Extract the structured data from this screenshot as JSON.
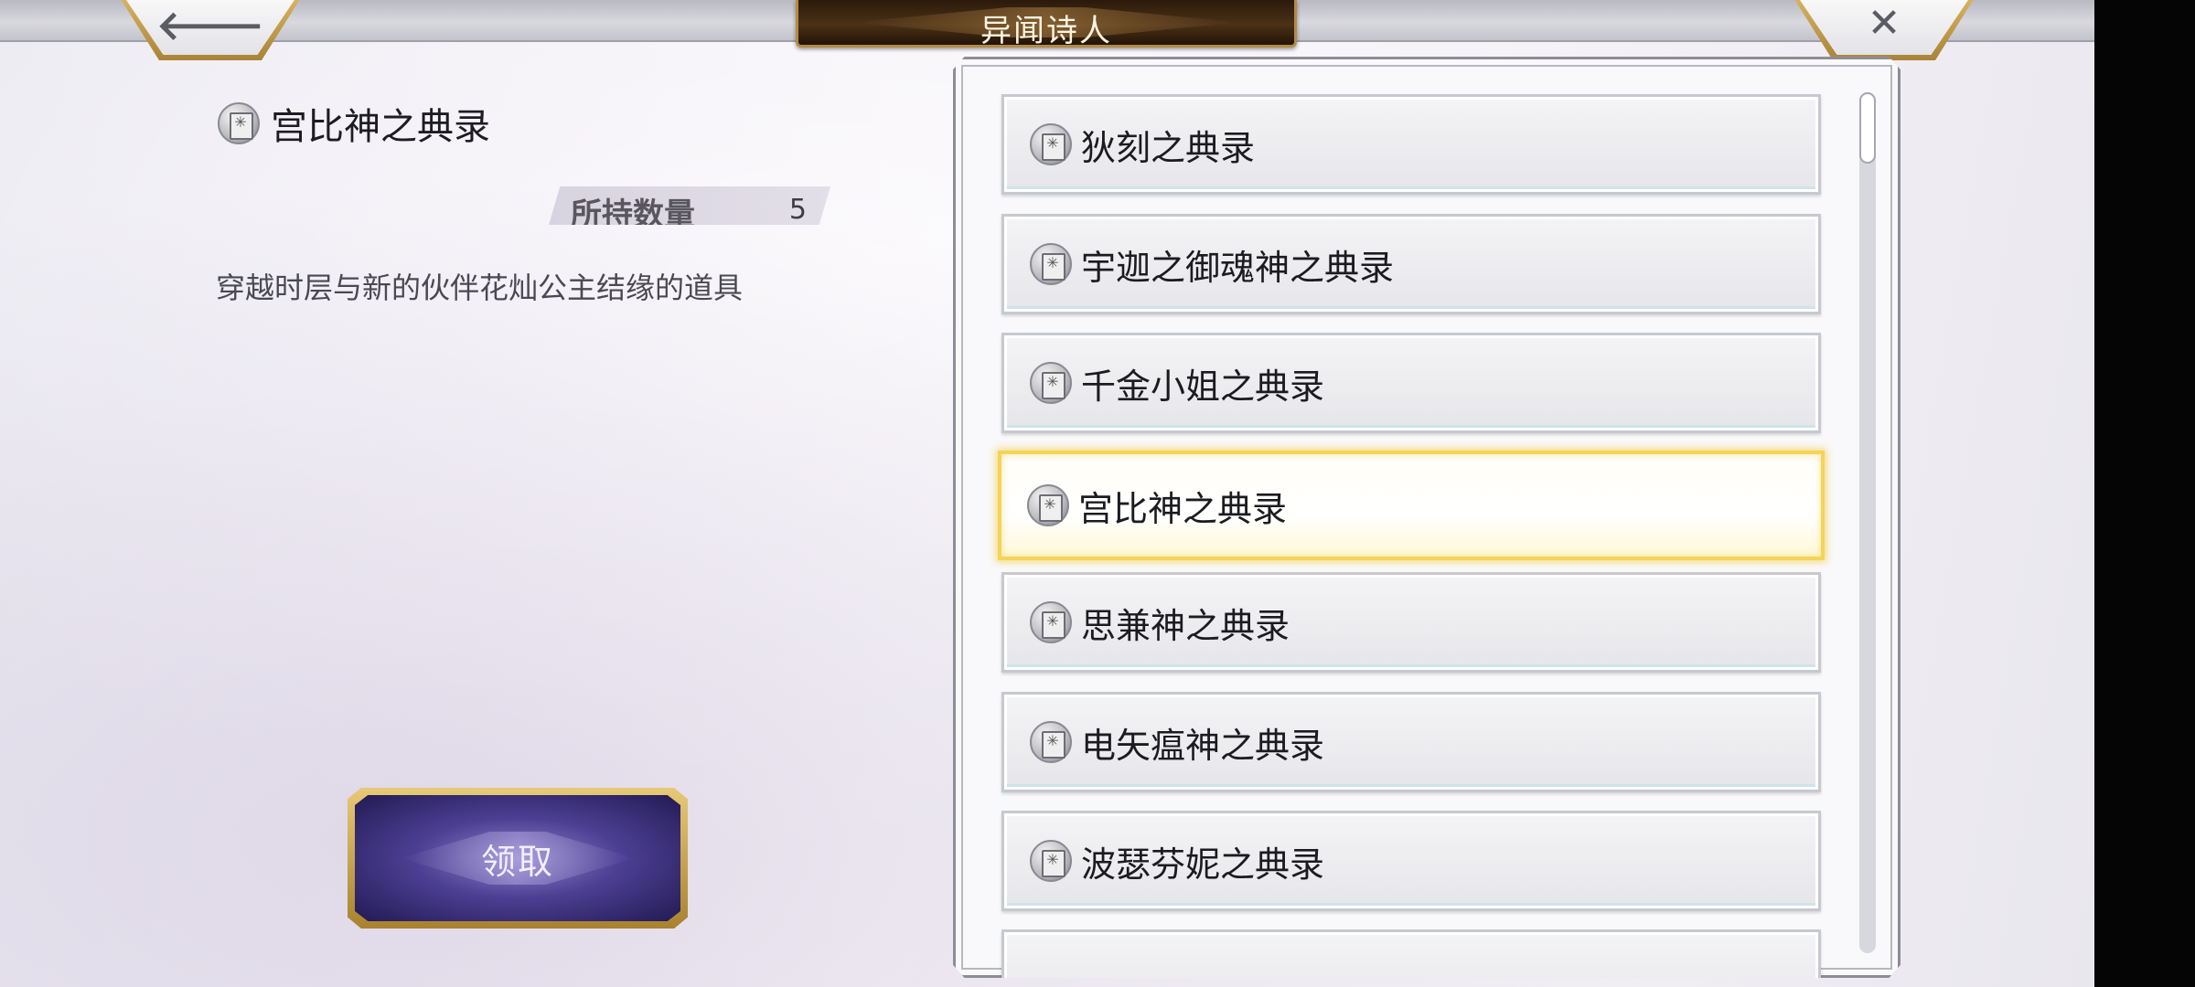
{
  "header": {
    "title": "异闻诗人",
    "back_icon": "arrow-left-icon",
    "close_icon": "close-x-icon"
  },
  "detail": {
    "item_name": "宫比神之典录",
    "quantity_label": "所持数量",
    "quantity_value": "5",
    "description": "穿越时层与新的伙伴花灿公主结缘的道具",
    "claim_button": "领取"
  },
  "list": {
    "items": [
      {
        "label": "狄刻之典录",
        "icon": "book-icon"
      },
      {
        "label": "宇迦之御魂神之典录",
        "icon": "book-icon"
      },
      {
        "label": "千金小姐之典录",
        "icon": "book-icon"
      },
      {
        "label": "宫比神之典录",
        "icon": "book-icon",
        "selected": true
      },
      {
        "label": "思兼神之典录",
        "icon": "book-icon"
      },
      {
        "label": "电矢瘟神之典录",
        "icon": "book-icon"
      },
      {
        "label": "波瑟芬妮之典录",
        "icon": "book-icon"
      },
      {
        "label": "",
        "icon": ""
      }
    ]
  },
  "colors": {
    "accent_gold": "#d9b463",
    "selected_border": "#f3d45a",
    "button_purple": "#4c3f93"
  }
}
